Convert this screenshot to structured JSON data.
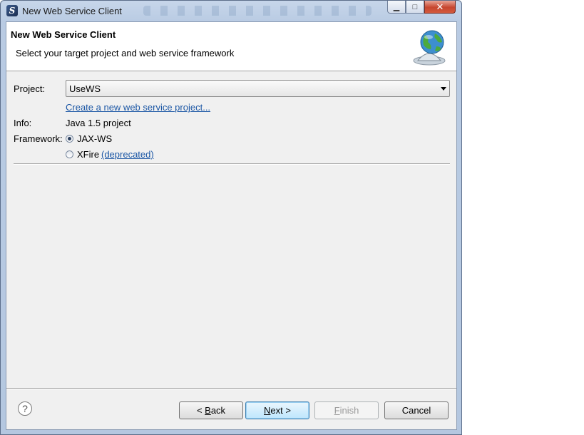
{
  "window": {
    "title": "New Web Service Client",
    "minimize_glyph": "▁",
    "maximize_glyph": "□",
    "close_glyph": "✕"
  },
  "header": {
    "title": "New Web Service Client",
    "description": "Select your target project and web service framework"
  },
  "form": {
    "project_label": "Project:",
    "project_value": "UseWS",
    "create_link": "Create a new web service project...",
    "info_label": "Info:",
    "info_value": "Java 1.5 project",
    "framework_label": "Framework:",
    "framework_options": [
      {
        "label": "JAX-WS",
        "selected": true
      },
      {
        "label": "XFire",
        "selected": false
      }
    ],
    "deprecated_link": "(deprecated)"
  },
  "buttons": {
    "help": "?",
    "back_prefix": "< ",
    "back_mnemonic": "B",
    "back_rest": "ack",
    "next_mnemonic": "N",
    "next_rest": "ext >",
    "finish_mnemonic": "F",
    "finish_rest": "inish",
    "cancel": "Cancel"
  }
}
